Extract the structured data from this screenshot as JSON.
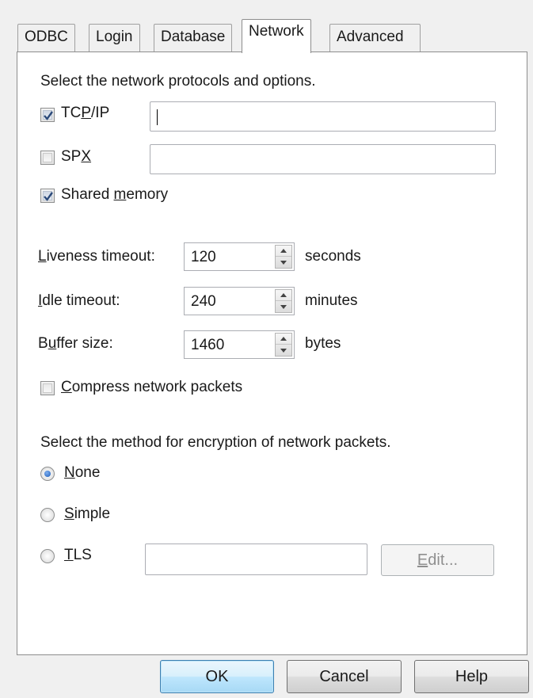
{
  "tabs": [
    {
      "label": "ODBC",
      "active": false
    },
    {
      "label": "Login",
      "active": false
    },
    {
      "label": "Database",
      "active": false
    },
    {
      "label": "Network",
      "active": true
    },
    {
      "label": "Advanced",
      "active": false
    }
  ],
  "network": {
    "protocols_heading": "Select the network protocols and options.",
    "tcpip": {
      "label_pre": "TC",
      "label_key": "P",
      "label_post": "/IP",
      "checked": true,
      "value": ""
    },
    "spx": {
      "label_pre": "SP",
      "label_key": "X",
      "label_post": "",
      "checked": false,
      "value": ""
    },
    "shared_memory": {
      "label_pre": "Shared ",
      "label_key": "m",
      "label_post": "emory",
      "checked": true
    },
    "liveness": {
      "label_pre": "",
      "label_key": "L",
      "label_post": "iveness timeout:",
      "value": "120",
      "unit": "seconds"
    },
    "idle": {
      "label_pre": "",
      "label_key": "I",
      "label_post": "dle timeout:",
      "value": "240",
      "unit": "minutes"
    },
    "buffer": {
      "label_pre": "B",
      "label_key": "u",
      "label_post": "ffer size:",
      "value": "1460",
      "unit": "bytes"
    },
    "compress": {
      "label_pre": "",
      "label_key": "C",
      "label_post": "ompress network packets",
      "checked": false
    },
    "encryption_heading": "Select the method for encryption of network packets.",
    "enc_none": {
      "label_pre": "",
      "label_key": "N",
      "label_post": "one",
      "selected": true
    },
    "enc_simple": {
      "label_pre": "",
      "label_key": "S",
      "label_post": "imple",
      "selected": false
    },
    "enc_tls": {
      "label_pre": "",
      "label_key": "T",
      "label_post": "LS",
      "selected": false,
      "value": ""
    },
    "edit_button": {
      "label_key": "E",
      "label_post": "dit..."
    }
  },
  "buttons": {
    "ok": "OK",
    "cancel": "Cancel",
    "help": "Help"
  }
}
